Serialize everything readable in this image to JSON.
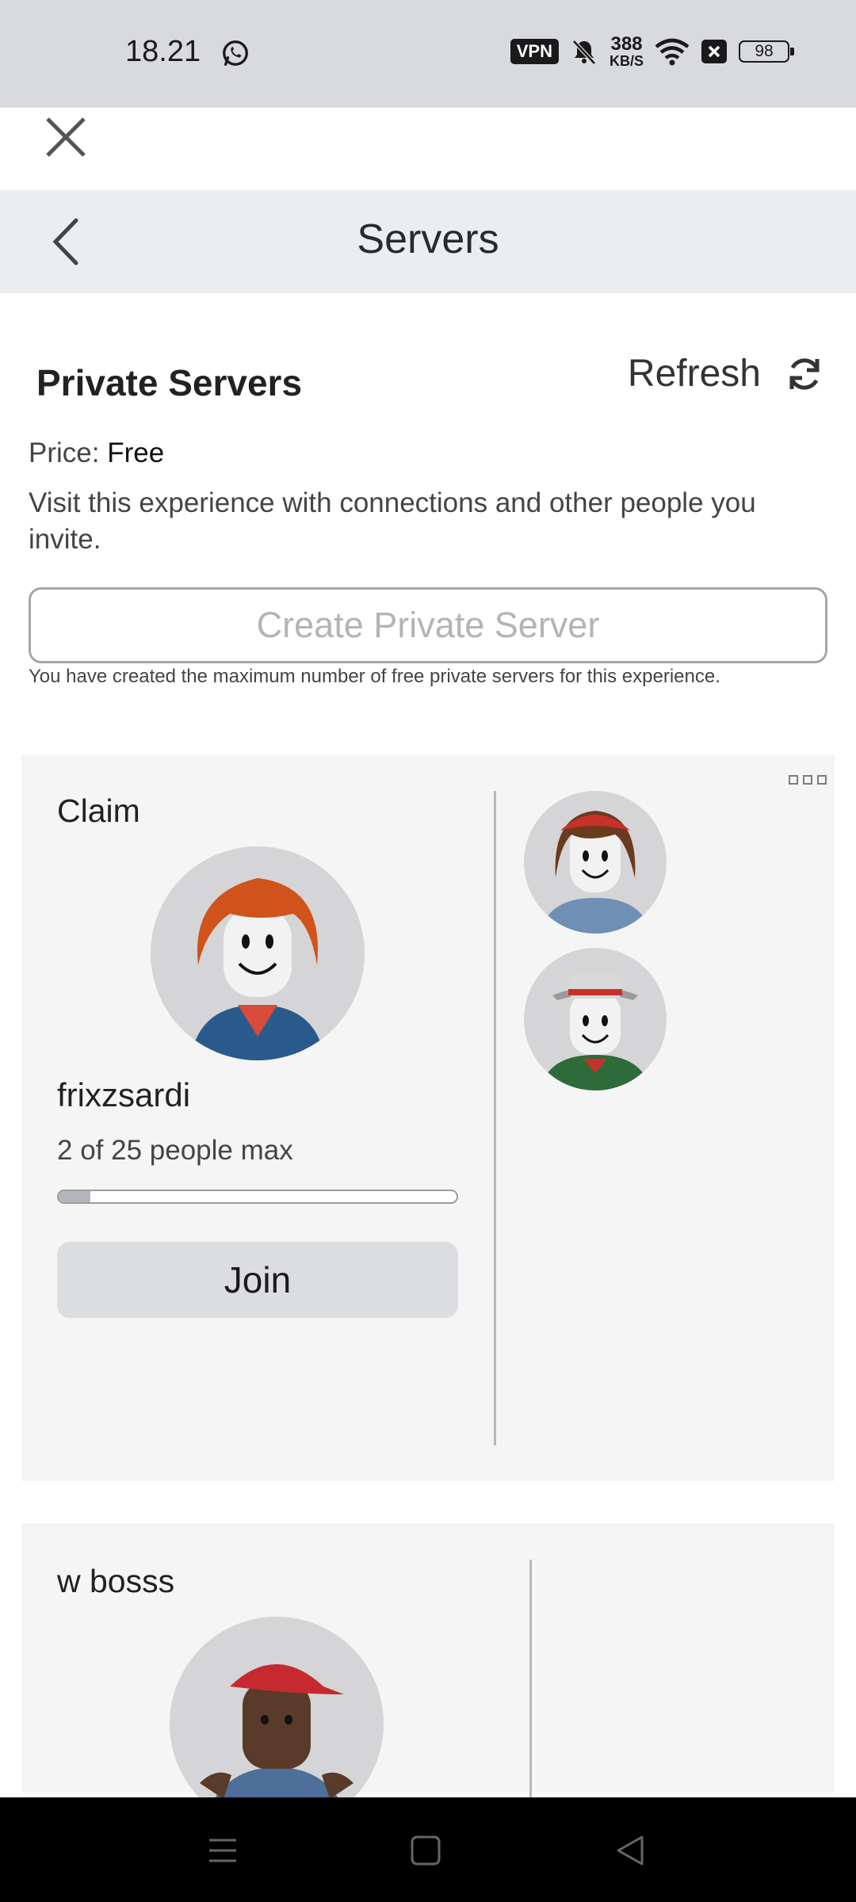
{
  "status_bar": {
    "time": "18.21",
    "vpn": "VPN",
    "speed_value": "388",
    "speed_unit": "KB/S",
    "battery": "98"
  },
  "header": {
    "title": "Servers"
  },
  "private_servers": {
    "title": "Private Servers",
    "refresh_label": "Refresh",
    "price_label": "Price:",
    "price_value": "Free",
    "description": "Visit this experience with connections and other people you invite.",
    "create_button": "Create Private Server",
    "max_note": "You have created the maximum number of free private servers for this experience."
  },
  "servers": [
    {
      "name": "Claim",
      "owner": "frixzsardi",
      "capacity_text": "2 of 25 people max",
      "players": 2,
      "max_players": 25,
      "join_label": "Join"
    },
    {
      "name": "w bosss"
    }
  ],
  "colors": {
    "status_bg": "#d8dadd",
    "header_bg": "#eaeef1",
    "card_bg": "#f5f5f5",
    "button_bg": "#dcdde0"
  }
}
